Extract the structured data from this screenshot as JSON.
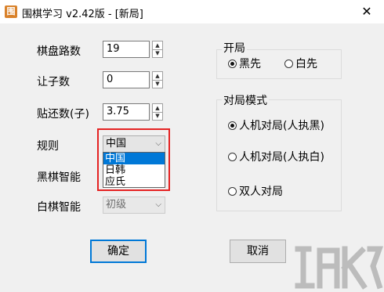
{
  "window": {
    "title": "围棋学习 v2.42版 - [新局]",
    "close": "✕",
    "app_icon": "围"
  },
  "fields": {
    "board_size": {
      "label": "棋盘路数",
      "value": "19"
    },
    "handicap": {
      "label": "让子数",
      "value": "0"
    },
    "komi": {
      "label": "贴还数(子)",
      "value": "3.75"
    },
    "rules": {
      "label": "规则",
      "value": "中国",
      "options": [
        "中国",
        "日韩",
        "应氏"
      ],
      "selected_index": 0
    },
    "black_ai": {
      "label": "黑棋智能"
    },
    "white_ai": {
      "label": "白棋智能",
      "value": "初级"
    }
  },
  "opening": {
    "title": "开局",
    "options": [
      "黑先",
      "白先"
    ],
    "selected": 0
  },
  "mode": {
    "title": "对局模式",
    "options": [
      "人机对局(人执黑)",
      "人机对局(人执白)",
      "双人对局"
    ],
    "selected": 0
  },
  "buttons": {
    "ok": "确定",
    "cancel": "取消"
  },
  "colors": {
    "highlight": "#0078d7",
    "annotation": "#e52222"
  }
}
